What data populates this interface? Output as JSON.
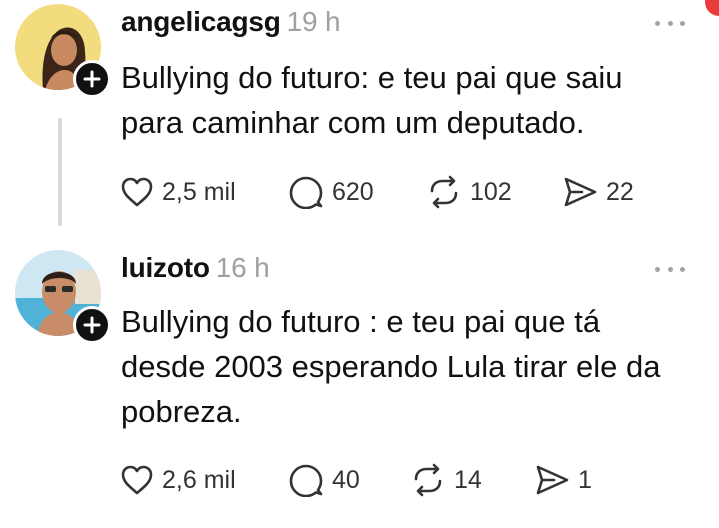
{
  "posts": [
    {
      "username": "angelicagsg",
      "time": "19 h",
      "text": "Bullying do futuro: e teu pai que saiu\npara caminhar com um deputado.",
      "likes": "2,5 mil",
      "replies": "620",
      "reposts": "102",
      "shares": "22"
    },
    {
      "username": "luizoto",
      "time": "16 h",
      "text": "Bullying do futuro : e teu pai que tá\ndesde 2003 esperando Lula tirar ele da\npobreza.",
      "likes": "2,6 mil",
      "replies": "40",
      "reposts": "14",
      "shares": "1"
    }
  ],
  "colors": {
    "text": "#111111",
    "muted": "#a0a0a0",
    "thread_line": "#d9d9d9",
    "badge": "#111111",
    "notification_dot": "#ea3a3a"
  },
  "icons": [
    "plus-icon",
    "more-icon",
    "heart-icon",
    "comment-icon",
    "repost-icon",
    "share-icon"
  ]
}
